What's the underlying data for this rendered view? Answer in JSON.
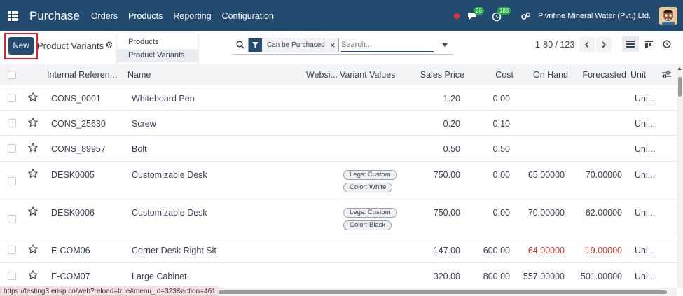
{
  "navbar": {
    "app_name": "Purchase",
    "menu": [
      "Orders",
      "Products",
      "Reporting",
      "Configuration"
    ],
    "messages_count": "26",
    "activities_count": "186",
    "company": "Pivrifine Mineral Water (Pvt.) Ltd."
  },
  "control_panel": {
    "new_label": "New",
    "title": "Product Variants",
    "dropdown": [
      "Products",
      "Product Variants"
    ],
    "facet_label": "Can be Purchased",
    "search_placeholder": "Search...",
    "pager": "1-80 / 123"
  },
  "table": {
    "columns": [
      "Internal Referen...",
      "Name",
      "Websi...",
      "Variant Values",
      "Sales Price",
      "Cost",
      "On Hand",
      "Forecasted",
      "Unit"
    ],
    "rows": [
      {
        "ref": "CONS_0001",
        "name": "Whiteboard Pen",
        "tags": [],
        "price": "1.20",
        "cost": "0.00",
        "onhand": "",
        "forecast": "",
        "unit": "Uni..."
      },
      {
        "ref": "CONS_25630",
        "name": "Screw",
        "tags": [],
        "price": "0.20",
        "cost": "0.10",
        "onhand": "",
        "forecast": "",
        "unit": "Uni..."
      },
      {
        "ref": "CONS_89957",
        "name": "Bolt",
        "tags": [],
        "price": "0.50",
        "cost": "0.50",
        "onhand": "",
        "forecast": "",
        "unit": "Uni..."
      },
      {
        "ref": "DESK0005",
        "name": "Customizable Desk",
        "tags": [
          "Legs: Custom",
          "Color: White"
        ],
        "price": "750.00",
        "cost": "0.00",
        "onhand": "65.00000",
        "forecast": "70.00000",
        "unit": "Uni..."
      },
      {
        "ref": "DESK0006",
        "name": "Customizable Desk",
        "tags": [
          "Legs: Custom",
          "Color: Black"
        ],
        "price": "750.00",
        "cost": "0.00",
        "onhand": "70.00000",
        "forecast": "62.00000",
        "unit": "Uni..."
      },
      {
        "ref": "E-COM06",
        "name": "Corner Desk Right Sit",
        "tags": [],
        "price": "147.00",
        "cost": "600.00",
        "onhand": "64.00000",
        "forecast": "-19.00000",
        "unit": "Uni..."
      },
      {
        "ref": "E-COM07",
        "name": "Large Cabinet",
        "tags": [],
        "price": "320.00",
        "cost": "800.00",
        "onhand": "557.00000",
        "forecast": "501.00000",
        "unit": "Uni..."
      }
    ]
  },
  "status_bar": {
    "url": "https://testing3.erisp.co/web?reload=true#menu_id=323&action=461"
  },
  "colors": {
    "primary": "#224b6f",
    "highlight": "#e21f2b",
    "negative": "#c0392b",
    "badge": "#28a745"
  }
}
